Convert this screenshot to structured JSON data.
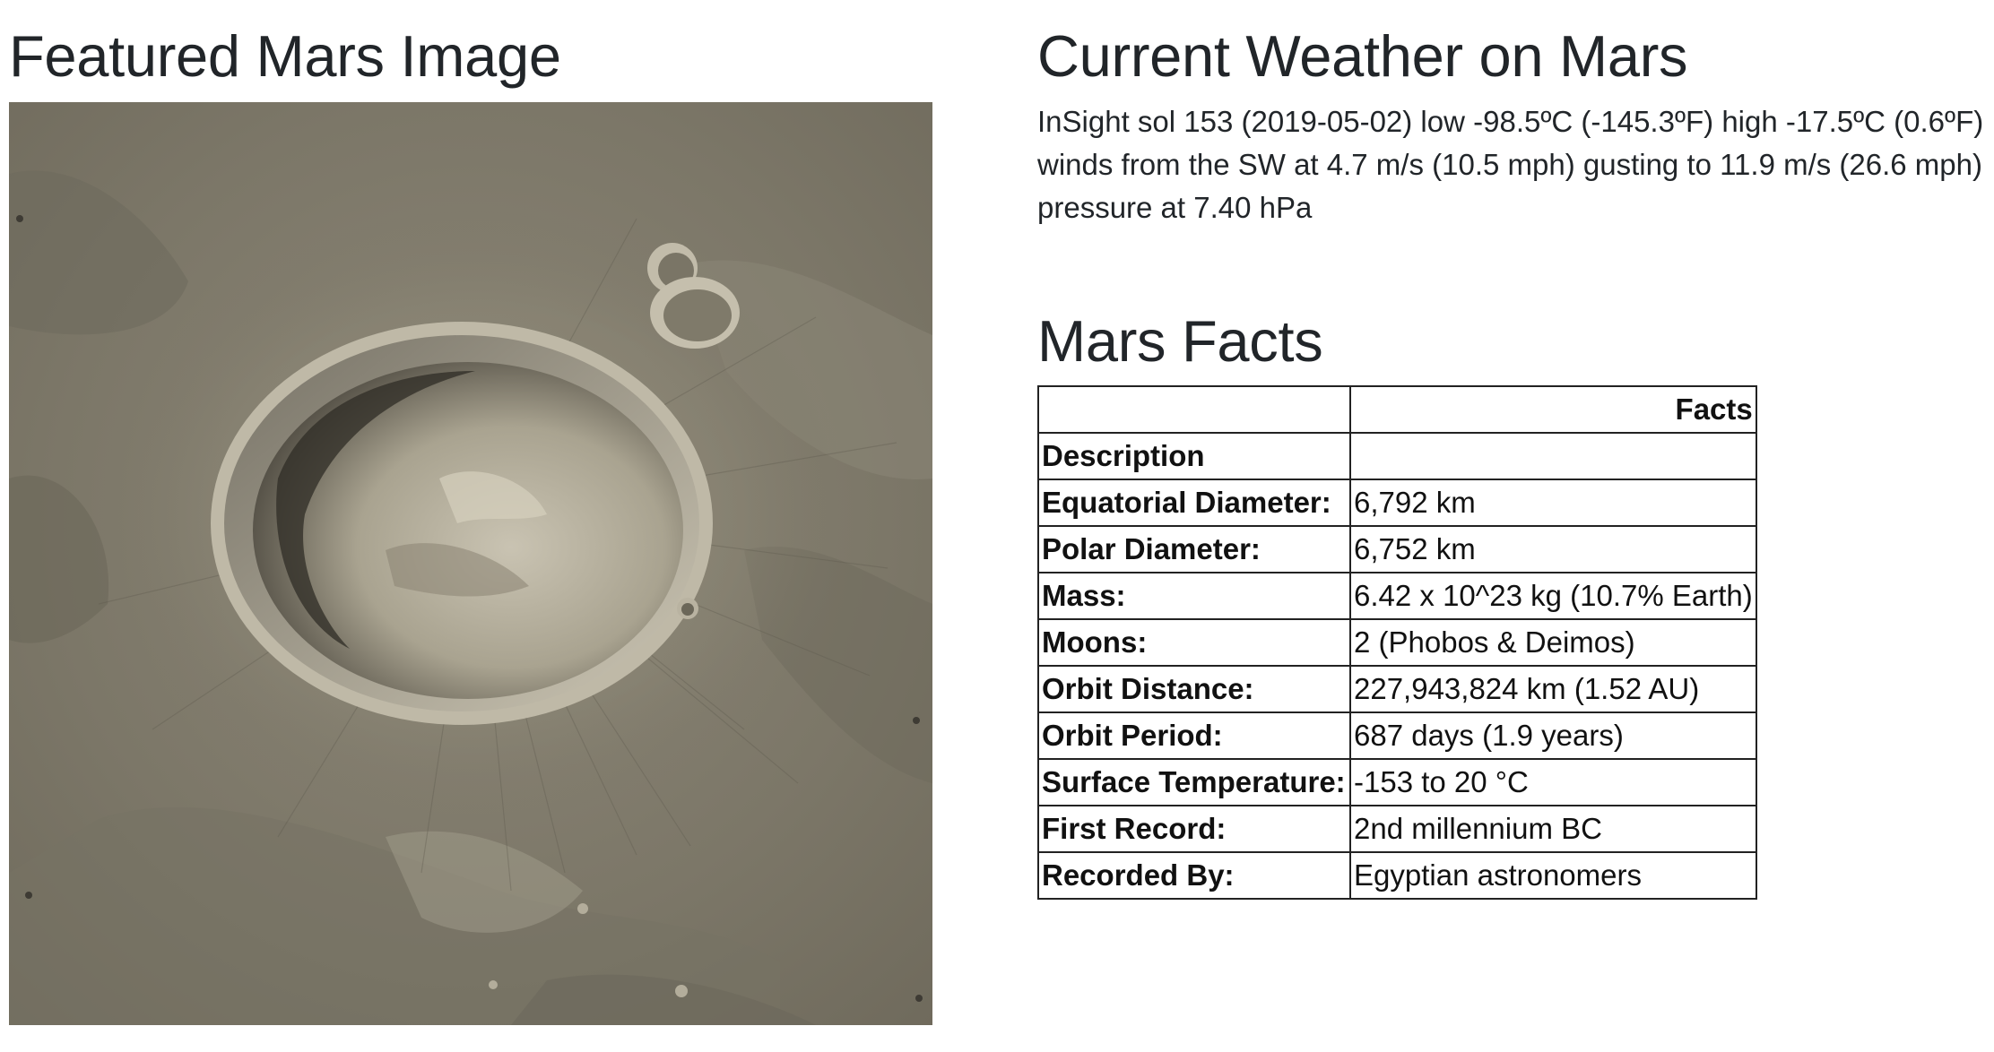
{
  "featured": {
    "title": "Featured Mars Image",
    "image_alt": "Mars crater surface"
  },
  "weather": {
    "title": "Current Weather on Mars",
    "text": "InSight sol 153 (2019-05-02) low -98.5ºC (-145.3ºF) high -17.5ºC (0.6ºF) winds from the SW at 4.7 m/s (10.5 mph) gusting to 11.9 m/s (26.6 mph) pressure at 7.40 hPa"
  },
  "facts": {
    "title": "Mars Facts",
    "header": {
      "label": "",
      "value": "Facts"
    },
    "index_label": "Description",
    "rows": [
      {
        "label": "Equatorial Diameter:",
        "value": "6,792 km"
      },
      {
        "label": "Polar Diameter:",
        "value": "6,752 km"
      },
      {
        "label": "Mass:",
        "value": "6.42 x 10^23 kg (10.7% Earth)"
      },
      {
        "label": "Moons:",
        "value": "2 (Phobos & Deimos)"
      },
      {
        "label": "Orbit Distance:",
        "value": "227,943,824 km (1.52 AU)"
      },
      {
        "label": "Orbit Period:",
        "value": "687 days (1.9 years)"
      },
      {
        "label": "Surface Temperature:",
        "value": "-153 to 20 °C"
      },
      {
        "label": "First Record:",
        "value": "2nd millennium BC"
      },
      {
        "label": "Recorded By:",
        "value": "Egyptian astronomers"
      }
    ]
  }
}
